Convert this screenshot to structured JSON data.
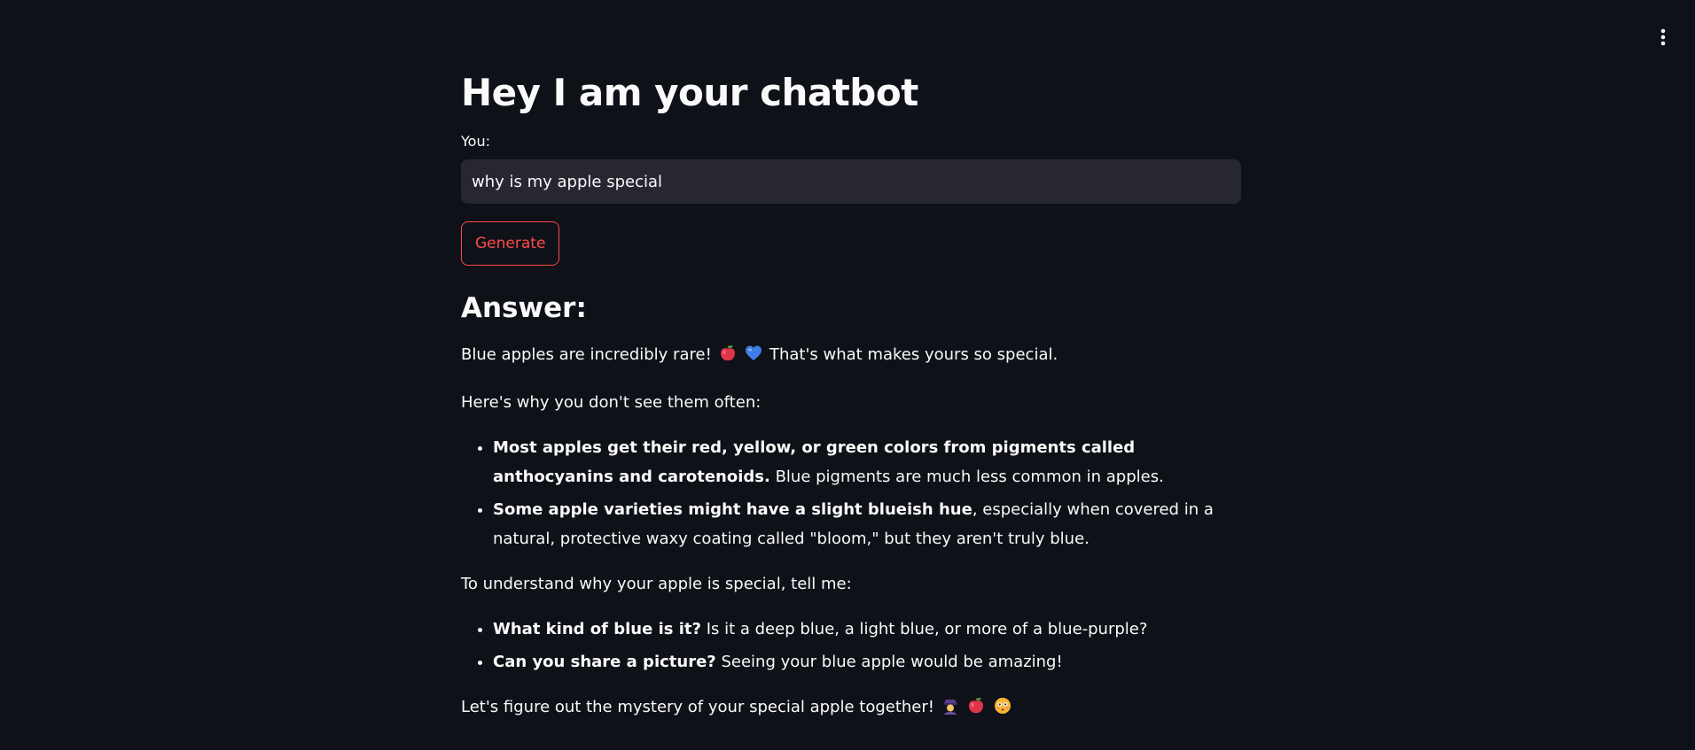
{
  "app": {
    "title": "Hey I am your chatbot",
    "menu_icon": "kebab-menu-icon"
  },
  "input": {
    "label": "You:",
    "value": "why is my apple special"
  },
  "generate_button": {
    "label": "Generate"
  },
  "answer": {
    "heading": "Answer:",
    "intro_text_1": "Blue apples are incredibly rare!",
    "intro_text_2": "That's what makes yours so special.",
    "why_intro": "Here's why you don't see them often:",
    "bullets_1": [
      {
        "bold": "Most apples get their red, yellow, or green colors from pigments called anthocyanins and carotenoids.",
        "text": " Blue pigments are much less common in apples."
      },
      {
        "bold": "Some apple varieties might have a slight blueish hue",
        "text": ", especially when covered in a natural, protective waxy coating called \"bloom,\" but they aren't truly blue."
      }
    ],
    "ask_intro": "To understand why your apple is special, tell me:",
    "bullets_2": [
      {
        "bold": "What kind of blue is it?",
        "text": " Is it a deep blue, a light blue, or more of a blue-purple?"
      },
      {
        "bold": "Can you share a picture?",
        "text": " Seeing your blue apple would be amazing!"
      }
    ],
    "closing": "Let's figure out the mystery of your special apple together!"
  },
  "icons": {
    "apple": "apple-emoji-icon",
    "heart": "blue-heart-emoji-icon",
    "detective": "detective-emoji-icon",
    "face": "flushed-face-emoji-icon"
  },
  "colors": {
    "background": "#0e1117",
    "input_background": "#262730",
    "accent": "#ff4b4b",
    "text": "#fafafa"
  }
}
